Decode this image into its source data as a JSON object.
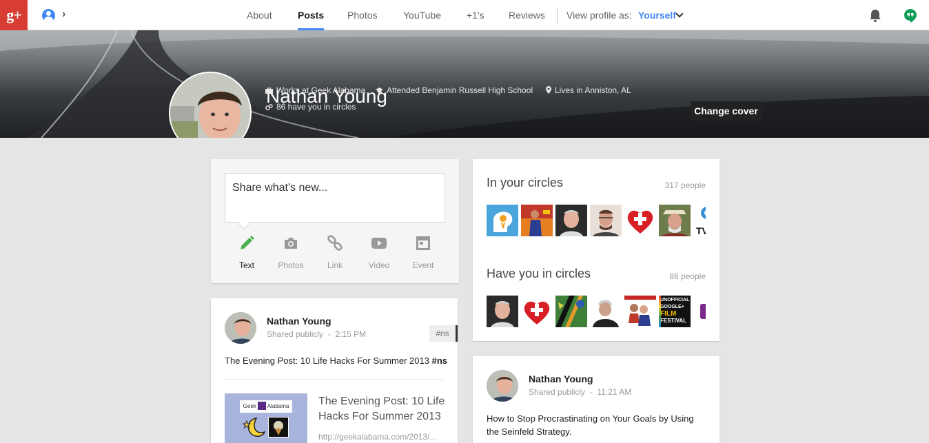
{
  "nav": {
    "logo": "g+",
    "tabs": [
      {
        "label": "About"
      },
      {
        "label": "Posts"
      },
      {
        "label": "Photos"
      },
      {
        "label": "YouTube"
      },
      {
        "label": "+1's"
      },
      {
        "label": "Reviews"
      }
    ],
    "active_tab": "Posts",
    "view_as_label": "View profile as:",
    "view_as_value": "Yourself"
  },
  "profile": {
    "name": "Nathan Young",
    "work": "Works at Geek Alabama",
    "school": "Attended Benjamin Russell High School",
    "location": "Lives in Anniston, AL",
    "circles": "86 have you in circles",
    "change_cover": "Change cover"
  },
  "share": {
    "placeholder": "Share what's new...",
    "options": [
      {
        "label": "Text",
        "icon": "pencil-icon"
      },
      {
        "label": "Photos",
        "icon": "camera-icon"
      },
      {
        "label": "Link",
        "icon": "link-icon"
      },
      {
        "label": "Video",
        "icon": "video-icon"
      },
      {
        "label": "Event",
        "icon": "event-icon"
      }
    ]
  },
  "post1": {
    "author": "Nathan Young",
    "shared": "Shared publicly",
    "time": "2:15 PM",
    "tag": "#ns",
    "text_main": "The Evening Post: 10 Life Hacks For Summer 2013",
    "text_tag": "#ns",
    "link_title": "The Evening Post: 10 Life Hacks For Summer 2013",
    "link_url": "http://geekalabama.com/2013/...",
    "thumb_site": {
      "left": "Geek",
      "right": "Alabama"
    }
  },
  "circles": {
    "in_title": "In your circles",
    "in_count": "317 people",
    "have_title": "Have you in circles",
    "have_count": "86 people",
    "in_faces": [
      "mind-logo",
      "runner",
      "man-smiling",
      "man-glasses",
      "heart-plus",
      "man-hat",
      "tv-logo"
    ],
    "have_faces": [
      "man-smiling",
      "heart-plus",
      "leaf-art",
      "man-cap",
      "woman-group",
      "film-festival",
      "purple-logo"
    ],
    "in_face7_text": "TV",
    "film_festival_text": [
      "UNOFFICIAL",
      "GOOGLE+",
      "FILM",
      "FESTIVAL"
    ]
  },
  "post2": {
    "author": "Nathan Young",
    "shared": "Shared publicly",
    "time": "11:21 AM",
    "text": "How to Stop Procrastinating on Your Goals by Using the Seinfeld Strategy."
  },
  "colors": {
    "brand_red": "#d73d32",
    "accent_blue": "#4285f4",
    "hangouts_green": "#0f9d58",
    "pencil_green": "#4caf50"
  }
}
